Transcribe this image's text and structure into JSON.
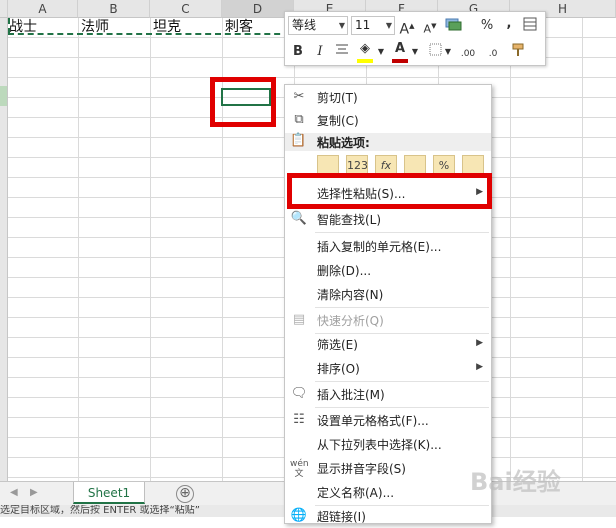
{
  "columns": [
    "A",
    "B",
    "C",
    "D",
    "E",
    "F",
    "G",
    "H"
  ],
  "cells": {
    "a1": "战士",
    "b1": "法师",
    "c1": "坦克",
    "d1": "刺客"
  },
  "sheet_tab": "Sheet1",
  "add_sheet_symbol": "⊕",
  "status_text": "选定目标区域，然后按 ENTER 或选择“粘贴”",
  "mini_toolbar": {
    "font_name": "等线",
    "font_size": "11",
    "increase_font": "A",
    "decrease_font": "A",
    "format_glyph": "%",
    "comma_glyph": ",",
    "bold": "B",
    "italic": "I",
    "font_color_glyph": "A",
    "decimal_increase": ".00",
    "decimal_decrease": ".0",
    "colors": {
      "highlight": "#ffff00",
      "font_color": "#c00000"
    }
  },
  "context_menu": {
    "items": [
      {
        "label": "剪切(T)",
        "icon": "scissors-icon"
      },
      {
        "label": "复制(C)",
        "icon": "copy-icon"
      },
      {
        "label": "粘贴选项:",
        "icon": "clipboard-icon"
      },
      {
        "label": "选择性粘贴(S)...",
        "icon": ""
      },
      {
        "label": "智能查找(L)",
        "icon": "smart-lookup-icon"
      },
      {
        "label": "插入复制的单元格(E)...",
        "icon": ""
      },
      {
        "label": "删除(D)...",
        "icon": ""
      },
      {
        "label": "清除内容(N)",
        "icon": ""
      },
      {
        "label": "快速分析(Q)",
        "icon": "quick-analysis-icon"
      },
      {
        "label": "筛选(E)",
        "icon": ""
      },
      {
        "label": "排序(O)",
        "icon": ""
      },
      {
        "label": "插入批注(M)",
        "icon": "comment-icon"
      },
      {
        "label": "设置单元格格式(F)...",
        "icon": "format-cells-icon"
      },
      {
        "label": "从下拉列表中选择(K)...",
        "icon": ""
      },
      {
        "label": "显示拼音字段(S)",
        "icon": "phonetic-icon"
      },
      {
        "label": "定义名称(A)...",
        "icon": ""
      },
      {
        "label": "超链接(I)",
        "icon": "hyperlink-icon"
      }
    ],
    "paste_button_glyphs": [
      "",
      "123",
      "fx",
      "",
      "%",
      ""
    ]
  },
  "watermark": "Bai经验",
  "accent_color": "#217346",
  "highlight_color": "#e00000"
}
